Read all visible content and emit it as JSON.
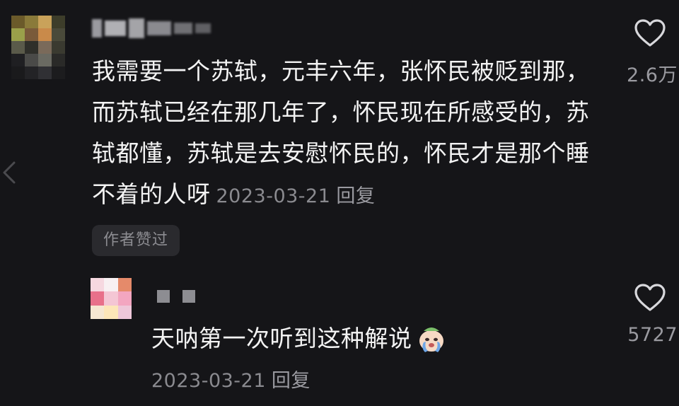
{
  "comment": {
    "text": "我需要一个苏轼，元丰六年，张怀民被贬到那，而苏轼已经在那几年了，怀民现在所感受的，苏轼都懂，苏轼是去安慰怀民的，怀民才是那个睡不着的人呀",
    "date": "2023-03-21",
    "reply_label": "回复",
    "author_badge": "作者赞过",
    "like_count": "2.6万",
    "avatar_colors": [
      "#6b5a2a",
      "#8a7a3a",
      "#c9a25a",
      "#3d3d2a",
      "#9aa04a",
      "#7a5a3a",
      "#c98a4a",
      "#4a4a3a",
      "#5a5a4a",
      "#2f2f2a",
      "#7a6a5a",
      "#3a3a30",
      "#1f1f22",
      "#4a4a48",
      "#6a6a62",
      "#2a2a28",
      "#1a1a1c",
      "#232326",
      "#303034",
      "#1c1c1e"
    ]
  },
  "reply": {
    "text": "天呐第一次听到这种解说",
    "date": "2023-03-21",
    "reply_label": "回复",
    "like_count": "5727",
    "avatar_colors": [
      "#f6d8e0",
      "#f8f0f2",
      "#e58a6a",
      "#e8708a",
      "#f4c6d4",
      "#f3a6c0",
      "#f6e7d2",
      "#fde6b8",
      "#eec7d9"
    ]
  },
  "icons": {
    "like": "heart-outline-icon",
    "back": "chevron-left-icon",
    "emoji": "crying-emoji-icon"
  },
  "colors": {
    "background": "#151518",
    "primary_text": "#f3f3f3",
    "secondary_text": "#8a8a8f"
  }
}
